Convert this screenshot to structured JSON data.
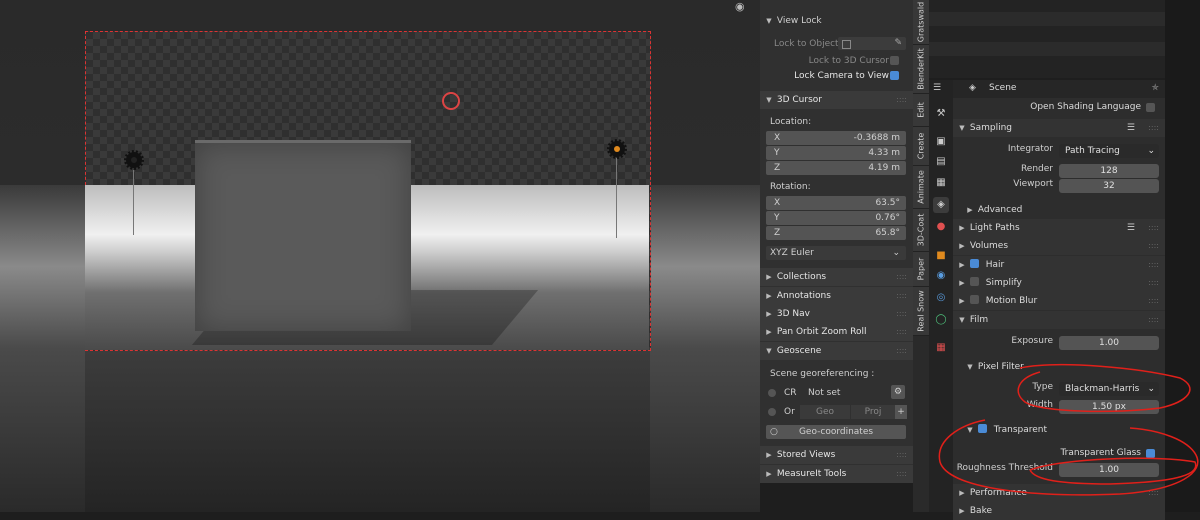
{
  "npanel": {
    "view_lock": {
      "title": "View Lock",
      "lock_to_object": "Lock to Object",
      "lock_to_3d_cursor": "Lock to 3D Cursor",
      "lock_camera_to_view": "Lock Camera to View"
    },
    "cursor": {
      "title": "3D Cursor",
      "location_label": "Location:",
      "location": [
        {
          "axis": "X",
          "value": "-0.3688 m"
        },
        {
          "axis": "Y",
          "value": "4.33 m"
        },
        {
          "axis": "Z",
          "value": "4.19 m"
        }
      ],
      "rotation_label": "Rotation:",
      "rotation": [
        {
          "axis": "X",
          "value": "63.5°"
        },
        {
          "axis": "Y",
          "value": "0.76°"
        },
        {
          "axis": "Z",
          "value": "65.8°"
        }
      ],
      "rotation_mode": "XYZ Euler"
    },
    "panels": [
      "Collections",
      "Annotations",
      "3D Nav",
      "Pan Orbit Zoom Roll"
    ],
    "geoscene": {
      "title": "Geoscene",
      "georef": "Scene georeferencing :",
      "cr": "CR",
      "not_set": "Not set",
      "or": "Or",
      "geo": "Geo",
      "proj": "Proj",
      "geo_coordinates": "Geo-coordinates"
    },
    "bottom_panels": [
      "Stored Views",
      "MeasureIt Tools"
    ]
  },
  "tabs": [
    "Gratswald",
    "BlenderKit",
    "Edit",
    "Create",
    "Animate",
    "3D-Coat",
    "Paper",
    "Real Snow"
  ],
  "properties": {
    "context": "Scene",
    "open_shading_language": "Open Shading Language",
    "sampling": "Sampling",
    "integrator_label": "Integrator",
    "integrator_value": "Path Tracing",
    "render_label": "Render",
    "render_value": "128",
    "viewport_label": "Viewport",
    "viewport_value": "32",
    "advanced": "Advanced",
    "light_paths": "Light Paths",
    "volumes": "Volumes",
    "hair": "Hair",
    "simplify": "Simplify",
    "motion_blur": "Motion Blur",
    "film": "Film",
    "exposure_label": "Exposure",
    "exposure_value": "1.00",
    "pixel_filter": "Pixel Filter",
    "type_label": "Type",
    "type_value": "Blackman-Harris",
    "width_label": "Width",
    "width_value": "1.50 px",
    "transparent": "Transparent",
    "transparent_glass": "Transparent Glass",
    "roughness_label": "Roughness Threshold",
    "roughness_value": "1.00",
    "performance": "Performance",
    "bake": "Bake"
  },
  "colors": {
    "accent": "#4a8bd6",
    "annotation": "#e0201a"
  }
}
